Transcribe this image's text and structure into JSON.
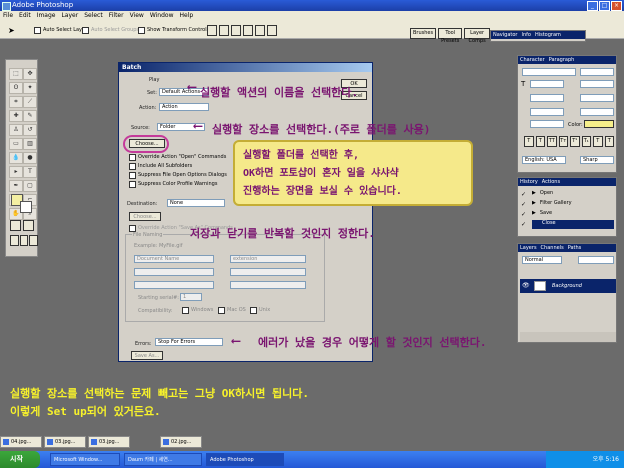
{
  "app": {
    "window_title": "Adobe Photoshop",
    "menu": [
      "File",
      "Edit",
      "Image",
      "Layer",
      "Select",
      "Filter",
      "View",
      "Window",
      "Help"
    ],
    "options": {
      "auto_select": "Auto Select Layer",
      "auto_groups": "Auto Select Groups",
      "show_transform": "Show Transform Controls"
    },
    "palette_well": [
      "Brushes",
      "Tool Presets",
      "Layer Comps"
    ]
  },
  "dialog": {
    "title": "Batch",
    "play_label": "Play",
    "set_label": "Set:",
    "set_value": "Default Actions",
    "action_label": "Action:",
    "action_value": "Action",
    "source_label": "Source:",
    "source_value": "Folder",
    "choose_label": "Choose...",
    "opts": [
      "Override Action \"Open\" Commands",
      "Include All Subfolders",
      "Suppress File Open Options Dialogs",
      "Suppress Color Profile Warnings"
    ],
    "ok": "OK",
    "cancel": "Cancel",
    "destination_label": "Destination:",
    "destination_value": "None",
    "dest_choose": "Choose...",
    "override_save": "Override Action \"Save As\" Commands",
    "file_naming": "File Naming",
    "example": "Example: MyFile.gif",
    "doc_name": "Document Name",
    "extension": "extension",
    "starting_serial": "Starting serial#:",
    "starting_serial_val": "1",
    "compat": "Compatibility:",
    "windows": "Windows",
    "macos": "Mac OS",
    "unix": "Unix",
    "errors_label": "Errors:",
    "errors_value": "Stop For Errors",
    "save_as": "Save As..."
  },
  "annotations": {
    "a1": "실행할 액션의 이름을 선택한다.",
    "a2": "실행할 장소를 선택한다.(주로 폴더를 사용)",
    "callout": [
      "실행할 폴더를 선택한 후,",
      "OK하면 포토샵이 혼자 일을 샤샤샥",
      "진행하는 장면을 보실 수 있습니다."
    ],
    "a3": "저장과 닫기를 반복할 것인지 정한다.",
    "a4": "에러가 났을 경우 어떻게 할 것인지 선택한다.",
    "bottom1": "실행할 장소를 선택하는 문제 빼고는 그냥 OK하시면 됩니다.",
    "bottom2": "이렇게 Set up되어 있거든요."
  },
  "navigator": {
    "tabs": [
      "Navigator",
      "Info",
      "Histogram"
    ]
  },
  "character": {
    "tabs": [
      "Character",
      "Paragraph"
    ],
    "color_label": "Color:",
    "language": "English: USA",
    "antialias": "Sharp"
  },
  "history": {
    "tabs": [
      "History",
      "Actions"
    ],
    "items": [
      "Open",
      "Filter Gallery",
      "Save",
      "Close"
    ]
  },
  "layers": {
    "tabs": [
      "Layers",
      "Channels",
      "Paths"
    ],
    "blend": "Normal",
    "layer_name": "Background"
  },
  "thumbs": [
    "04.jpg...",
    "03.jpg...",
    "03.jpg...",
    "02.jpg..."
  ],
  "taskbar": {
    "start": "시작",
    "items": [
      "Microsoft Window...",
      "Daum 카페 | 세연...",
      "Adobe Photoshop"
    ],
    "clock": "오후 5:16"
  }
}
